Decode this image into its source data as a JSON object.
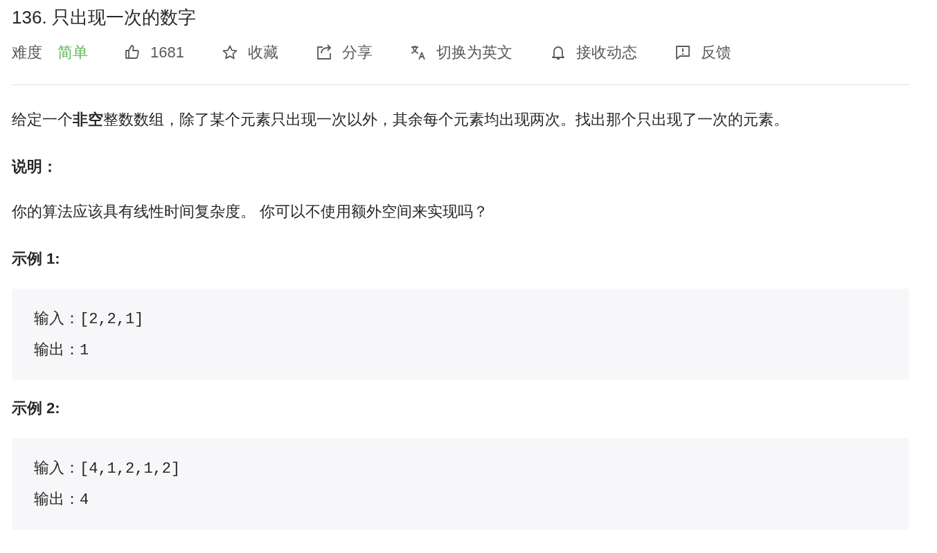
{
  "title": "136. 只出现一次的数字",
  "meta": {
    "difficulty_label": "难度",
    "difficulty": "简单"
  },
  "actions": [
    {
      "kind": "like",
      "label": "1681"
    },
    {
      "kind": "star",
      "label": "收藏"
    },
    {
      "kind": "share",
      "label": "分享"
    },
    {
      "kind": "translate",
      "label": "切换为英文"
    },
    {
      "kind": "bell",
      "label": "接收动态"
    },
    {
      "kind": "feedback",
      "label": "反馈"
    }
  ],
  "content": [
    {
      "kind": "paragraph",
      "text": "给定一个**非空**整数数组，除了某个元素只出现一次以外，其余每个元素均出现两次。找出那个只出现了一次的元素。"
    },
    {
      "kind": "heading",
      "text": "说明："
    },
    {
      "kind": "paragraph",
      "text": "你的算法应该具有线性时间复杂度。 你可以不使用额外空间来实现吗？"
    },
    {
      "kind": "heading",
      "text": "示例 1:"
    },
    {
      "kind": "code",
      "lines": [
        "输入：[2,2,1]",
        "输出：1"
      ]
    },
    {
      "kind": "heading",
      "text": "示例 2:"
    },
    {
      "kind": "code",
      "lines": [
        "输入：[4,1,2,1,2]",
        "输出：4"
      ]
    }
  ]
}
